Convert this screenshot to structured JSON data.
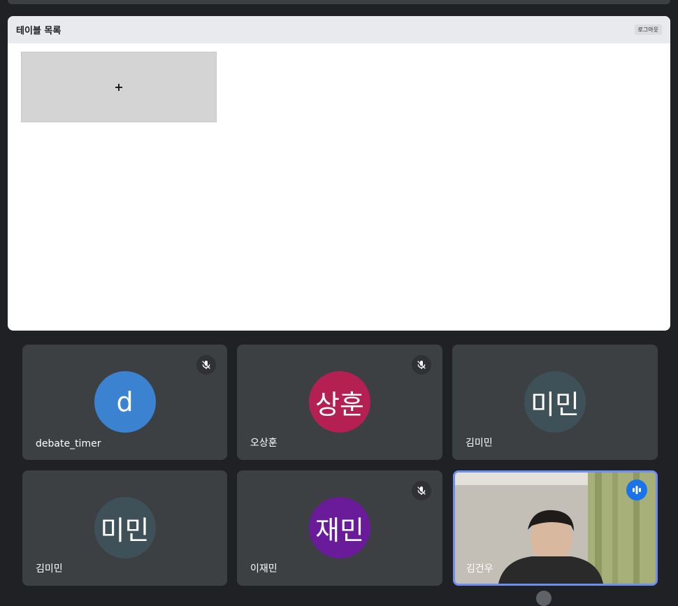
{
  "shared_screen": {
    "title": "테이블 목록",
    "logout_label": "로그아웃",
    "add_table_label": "+"
  },
  "participants": [
    {
      "name": "debate_timer",
      "avatar_text": "d",
      "avatar_color": "#3b82d0",
      "muted": true
    },
    {
      "name": "오상훈",
      "avatar_text": "상훈",
      "avatar_color": "#b32051",
      "muted": true
    },
    {
      "name": "김미민",
      "avatar_text": "미민",
      "avatar_color": "#3e5058",
      "muted": false
    },
    {
      "name": "김미민",
      "avatar_text": "미민",
      "avatar_color": "#3e5058",
      "muted": false
    },
    {
      "name": "이재민",
      "avatar_text": "재민",
      "avatar_color": "#6a1b9a",
      "muted": true
    },
    {
      "name": "김건우",
      "video": true,
      "speaking": true
    }
  ]
}
